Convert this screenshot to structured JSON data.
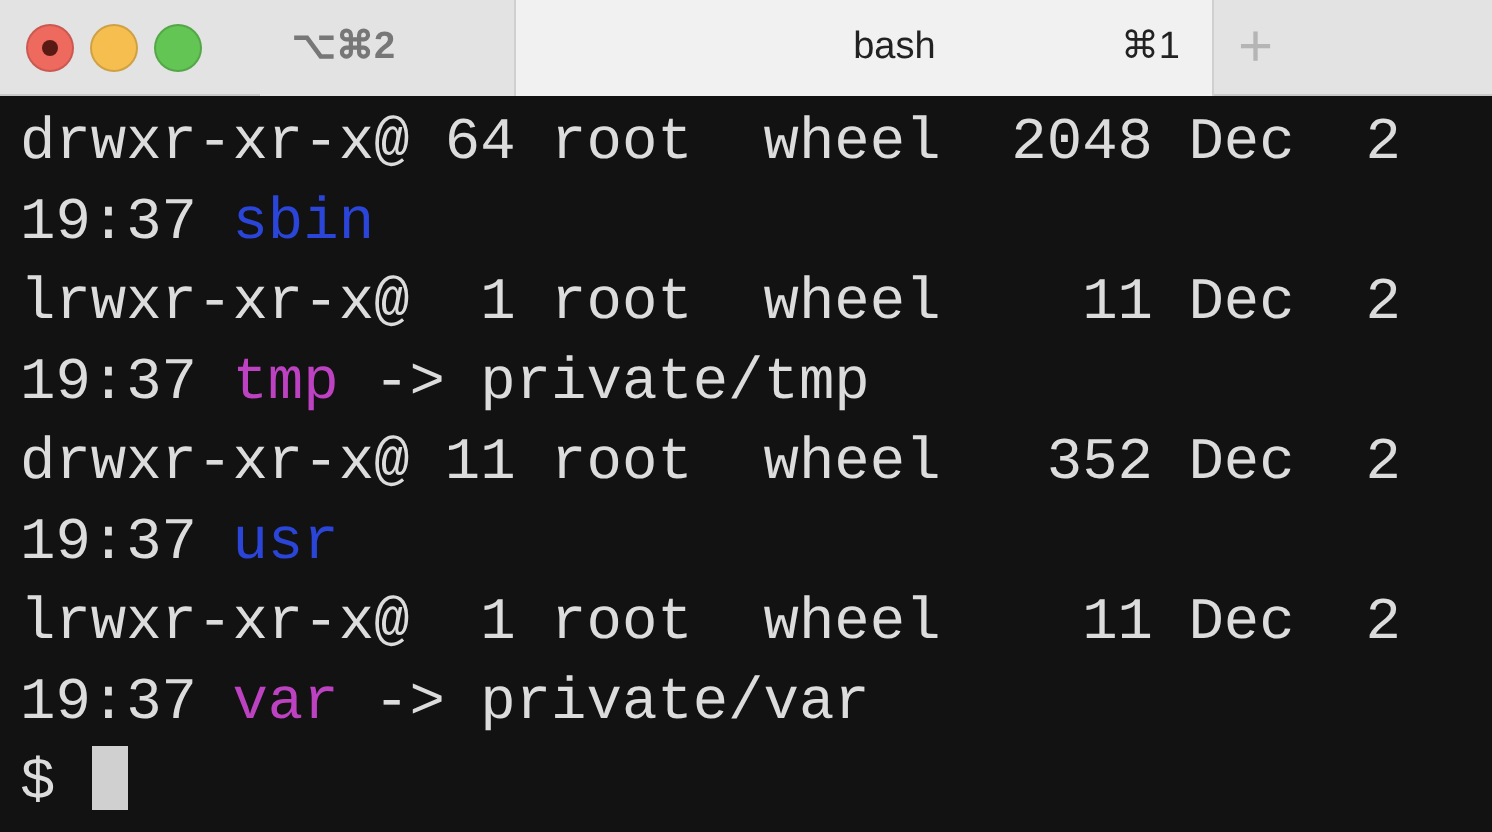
{
  "window": {
    "buttons": [
      {
        "kind": "close"
      },
      {
        "kind": "minimize"
      },
      {
        "kind": "zoom"
      }
    ]
  },
  "tabs": [
    {
      "shortcut": "⌥⌘2",
      "selected": false
    },
    {
      "title": "bash",
      "shortcut": "⌘1",
      "selected": true
    }
  ],
  "new_tab_button": "+",
  "terminal": {
    "lines": [
      {
        "segments": [
          {
            "text": "drwxr-xr-x@ 64 root  wheel  2048 Dec  2",
            "kind": "plain"
          }
        ]
      },
      {
        "segments": [
          {
            "text": "19:37 ",
            "kind": "plain"
          },
          {
            "text": "sbin",
            "kind": "directory"
          }
        ]
      },
      {
        "segments": [
          {
            "text": "lrwxr-xr-x@  1 root  wheel    11 Dec  2",
            "kind": "plain"
          }
        ]
      },
      {
        "segments": [
          {
            "text": "19:37 ",
            "kind": "plain"
          },
          {
            "text": "tmp",
            "kind": "symlink"
          },
          {
            "text": " -> private/tmp",
            "kind": "plain"
          }
        ]
      },
      {
        "segments": [
          {
            "text": "drwxr-xr-x@ 11 root  wheel   352 Dec  2",
            "kind": "plain"
          }
        ]
      },
      {
        "segments": [
          {
            "text": "19:37 ",
            "kind": "plain"
          },
          {
            "text": "usr",
            "kind": "directory"
          }
        ]
      },
      {
        "segments": [
          {
            "text": "lrwxr-xr-x@  1 root  wheel    11 Dec  2",
            "kind": "plain"
          }
        ]
      },
      {
        "segments": [
          {
            "text": "19:37 ",
            "kind": "plain"
          },
          {
            "text": "var",
            "kind": "symlink"
          },
          {
            "text": " -> private/var",
            "kind": "plain"
          }
        ]
      }
    ],
    "prompt": "$"
  }
}
